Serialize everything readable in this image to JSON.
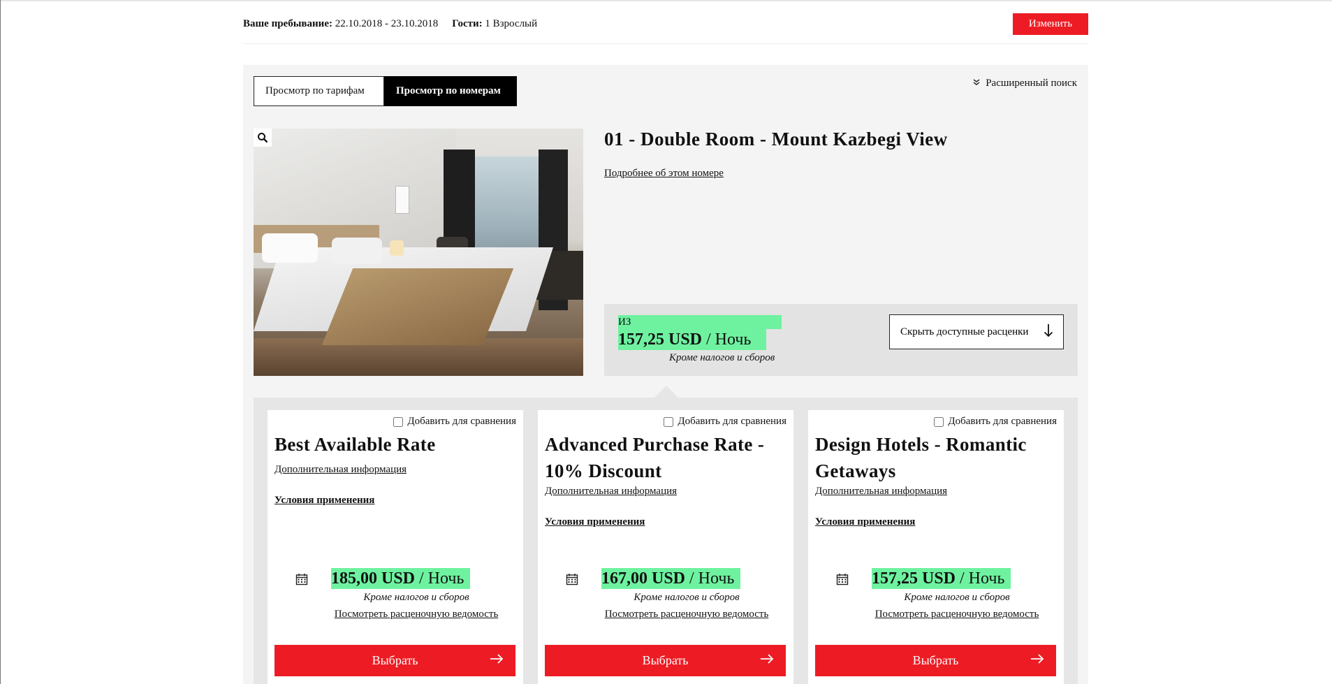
{
  "stay": {
    "label": "Ваше пребывание:",
    "dates": "22.10.2018 - 23.10.2018",
    "guests_label": "Гости:",
    "guests_value": "1 Взрослый",
    "change_button": "Изменить"
  },
  "tabs": [
    {
      "label": "Просмотр по тарифам",
      "active": false
    },
    {
      "label": "Просмотр по номерам",
      "active": true
    }
  ],
  "advanced_search": "Расширенный поиск",
  "room": {
    "title": "01 - Double Room - Mount Kazbegi View",
    "more_link": "Подробнее об этом номере",
    "from_label": "ИЗ",
    "from_price": "157,25 USD",
    "per_night": "/ Ночь",
    "tax_note": "Кроме налогов и сборов",
    "hide_rates_button": "Скрыть доступные расценки"
  },
  "rates": [
    {
      "compare_label": "Добавить для сравнения",
      "name": "Best Available Rate",
      "info_link": "Дополнительная информация",
      "terms_link": "Условия применения",
      "price": "185,00 USD",
      "per_night": "/ Ночь",
      "tax_note": "Кроме налогов и сборов",
      "statement_link": "Посмотреть расценочную ведомость",
      "select_button": "Выбрать"
    },
    {
      "compare_label": "Добавить для сравнения",
      "name": "Advanced Purchase Rate - 10% Discount",
      "info_link": "Дополнительная информация",
      "terms_link": "Условия применения",
      "price": "167,00 USD",
      "per_night": "/ Ночь",
      "tax_note": "Кроме налогов и сборов",
      "statement_link": "Посмотреть расценочную ведомость",
      "select_button": "Выбрать"
    },
    {
      "compare_label": "Добавить для сравнения",
      "name": "Design Hotels - Romantic Getaways",
      "info_link": "Дополнительная информация",
      "terms_link": "Условия применения",
      "price": "157,25 USD",
      "per_night": "/ Ночь",
      "tax_note": "Кроме налогов и сборов",
      "statement_link": "Посмотреть расценочную ведомость",
      "select_button": "Выбрать"
    }
  ],
  "icons": {
    "zoom": "magnifier-icon",
    "calendar": "calendar-icon",
    "arrow_down": "arrow-down-icon",
    "arrow_right": "arrow-right-icon",
    "chevron": "double-chevron-down-icon"
  },
  "colors": {
    "accent_red": "#ed1c24",
    "highlight_green": "#6ef2a0",
    "panel_gray": "#f4f4f4",
    "rates_gray": "#e6e6e6"
  }
}
